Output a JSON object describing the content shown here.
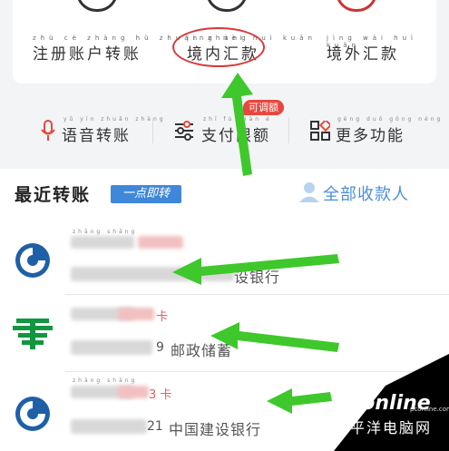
{
  "top_actions": {
    "register_transfer": {
      "pinyin": "zhù cè zhàng hù zhuǎn zhàng",
      "label": "注册账户转账"
    },
    "domestic_remit": {
      "pinyin": "jìng nèi huì kuǎn",
      "label": "境内汇款"
    },
    "overseas_remit": {
      "pinyin": "jìng wài huì kuǎn",
      "label": "境外汇款"
    }
  },
  "quick_actions": {
    "voice_transfer": {
      "pinyin": "yǔ yīn zhuǎn zhàng",
      "label": "语音转账"
    },
    "pay_limit": {
      "pinyin": "zhī fù xiàn é",
      "label": "支付限额",
      "badge": "可调额"
    },
    "more": {
      "pinyin": "gèng duō gōng néng",
      "label": "更多功能"
    }
  },
  "recent": {
    "title": "最近转账",
    "tag": "一点即转",
    "all_payees": "全部收款人",
    "items": [
      {
        "name_pinyin": "zhāng shāng",
        "bank": "设银行",
        "bank_prefix_digit": "",
        "card": ""
      },
      {
        "name_pinyin": "",
        "bank": "邮政储蓄",
        "bank_prefix_digit": "9",
        "card": "卡"
      },
      {
        "name_pinyin": "zhāng shāng",
        "bank": "中国建设银行",
        "bank_prefix_digit": "21",
        "card": "3 卡"
      }
    ]
  },
  "watermark": {
    "brand": "PConline",
    "cn": "太平洋电脑网",
    "url": "pconline.com.cn"
  },
  "colors": {
    "accent_blue": "#3f87d8",
    "annotation_green": "#3ec82c",
    "badge_red": "#e8473f",
    "ccb_blue": "#1f5fa8",
    "postal_green": "#12963f"
  }
}
